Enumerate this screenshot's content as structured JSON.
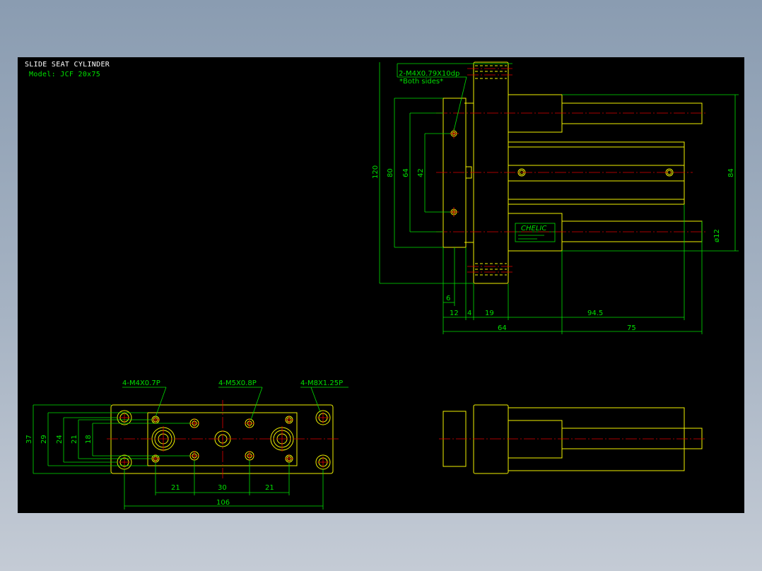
{
  "title_block": {
    "title": "SLIDE SEAT CYLINDER",
    "model": "Model: JCF 20x75"
  },
  "colors": {
    "geometry": "#f0f000",
    "dimension": "#00e000",
    "centerline": "#e00000",
    "title_text": "#ffffff",
    "background": "#000000"
  },
  "side_view": {
    "callout_thread": "2-M4X0.79X10dp",
    "callout_note": "*Both sides*",
    "dims": {
      "d120": "120",
      "d80": "80",
      "d64v": "64",
      "d42": "42",
      "d84": "84",
      "d12dia": "ø12",
      "d6": "6",
      "d12": "12",
      "d4": "4",
      "d19": "19",
      "d94_5": "94.5",
      "d64h": "64",
      "d75": "75"
    },
    "logo_text": "CHELIC"
  },
  "front_view": {
    "callout_m4": "4-M4X0.7P",
    "callout_m5": "4-M5X0.8P",
    "callout_m8": "4-M8X1.25P",
    "dims": {
      "d37": "37",
      "d29": "29",
      "d24": "24",
      "d21v": "21",
      "d18": "18",
      "d21a": "21",
      "d30": "30",
      "d21b": "21",
      "d106": "106"
    }
  }
}
